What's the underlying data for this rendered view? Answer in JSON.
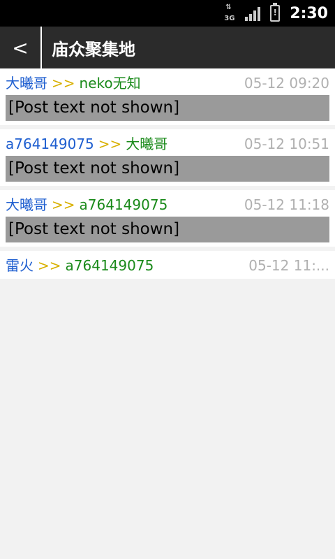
{
  "status_bar": {
    "network_type": "3G",
    "time": "2:30"
  },
  "title_bar": {
    "back_label": "<",
    "title": "庙众聚集地"
  },
  "posts": [
    {
      "author": "大曦哥",
      "separator": ">>",
      "reply_to": "neko无知",
      "time": "05-12 09:20",
      "body": "[Post text not shown]"
    },
    {
      "author": "a764149075",
      "separator": ">>",
      "reply_to": "大曦哥",
      "time": "05-12 10:51",
      "body": "[Post text not shown]"
    },
    {
      "author": "大曦哥",
      "separator": ">>",
      "reply_to": "a764149075",
      "time": "05-12 11:18",
      "body": "[Post text not shown]"
    },
    {
      "author": "雷火",
      "separator": ">>",
      "reply_to": "a764149075",
      "time": "05-12 11:...",
      "body": ""
    }
  ]
}
